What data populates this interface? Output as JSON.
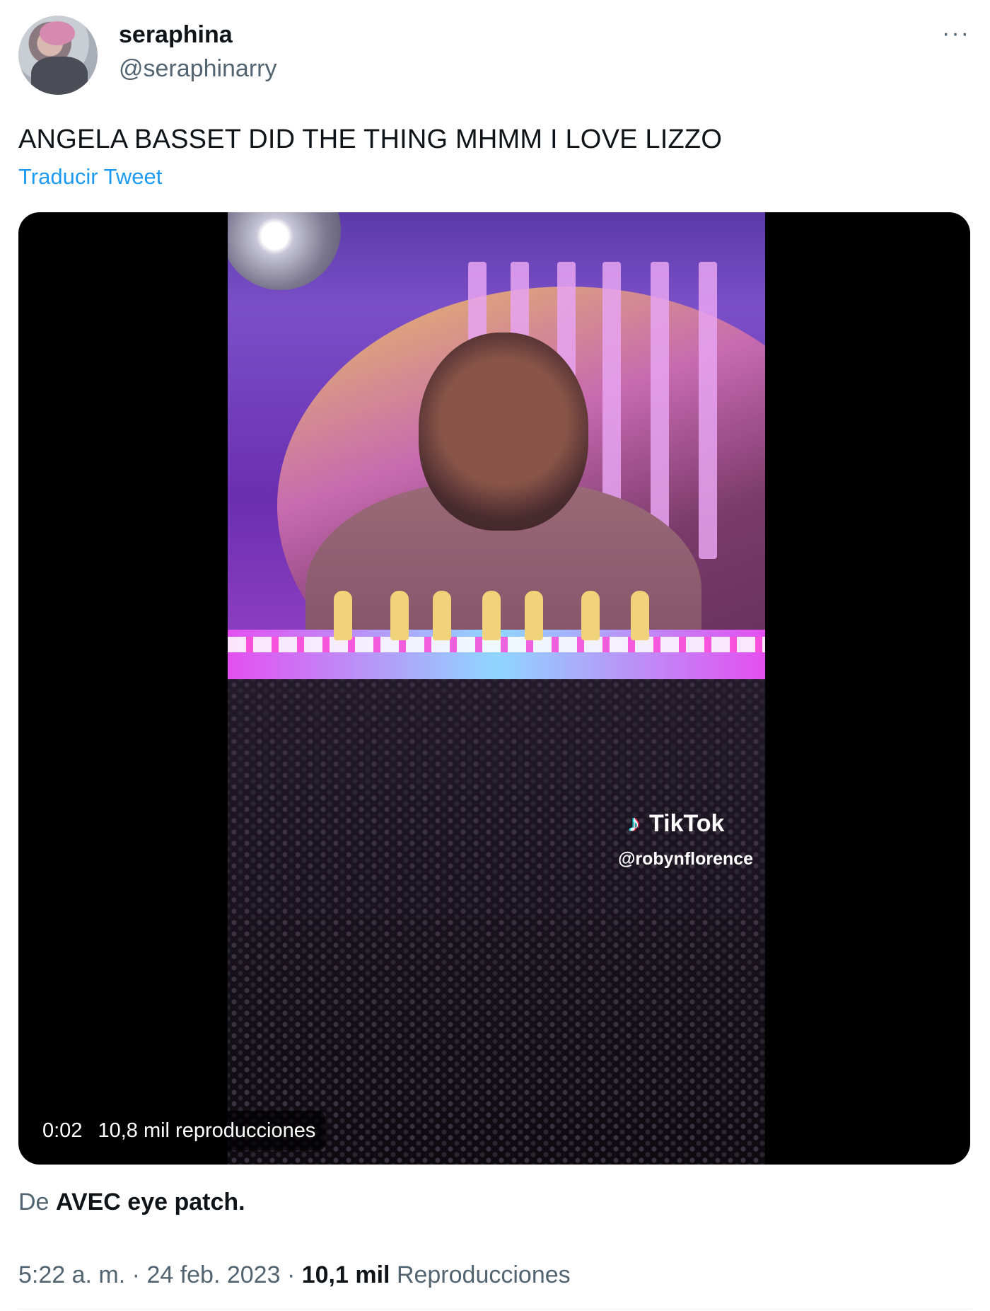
{
  "author": {
    "display_name": "seraphina",
    "handle": "@seraphinarry"
  },
  "more_label": "···",
  "tweet": {
    "text": "ANGELA BASSET DID THE THING MHMM I LOVE LIZZO",
    "translate_label": "Traducir Tweet"
  },
  "video": {
    "duration": "0:02",
    "views": "10,8 mil reproducciones",
    "watermark_brand": "TikTok",
    "watermark_handle": "@robynflorence"
  },
  "source": {
    "prefix": "De",
    "name": "AVEC eye patch."
  },
  "meta": {
    "time": "5:22 a. m.",
    "separator": "·",
    "date": "24 feb. 2023",
    "views_count": "10,1 mil",
    "views_label": "Reproducciones"
  },
  "colors": {
    "link": "#1d9bf0",
    "secondary_text": "#536471",
    "primary_text": "#0f1419"
  }
}
